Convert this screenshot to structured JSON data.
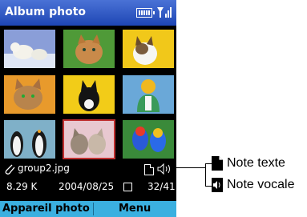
{
  "app": {
    "title": "Album photo"
  },
  "status": {
    "battery_icon": "battery-icon",
    "signal_icon": "signal-icon"
  },
  "photos": [
    {
      "name": "polar-bears"
    },
    {
      "name": "cat-green"
    },
    {
      "name": "kitten-yellow"
    },
    {
      "name": "cat-orange"
    },
    {
      "name": "black-cat-yellow"
    },
    {
      "name": "contact-avatar"
    },
    {
      "name": "penguins"
    },
    {
      "name": "kittens-pink",
      "selected": true
    },
    {
      "name": "parrots"
    }
  ],
  "file": {
    "name": "group2.jpg",
    "size": "8.29 K",
    "date": "2004/08/25",
    "position": "32/41"
  },
  "softkeys": {
    "left": "Appareil photo",
    "right": "Menu"
  },
  "legend": {
    "text_note": "Note texte",
    "voice_note": "Note vocale"
  },
  "colors": {
    "titlebar": "#1e46b4",
    "softbar": "#3bb0e0",
    "selection": "#c03030"
  }
}
